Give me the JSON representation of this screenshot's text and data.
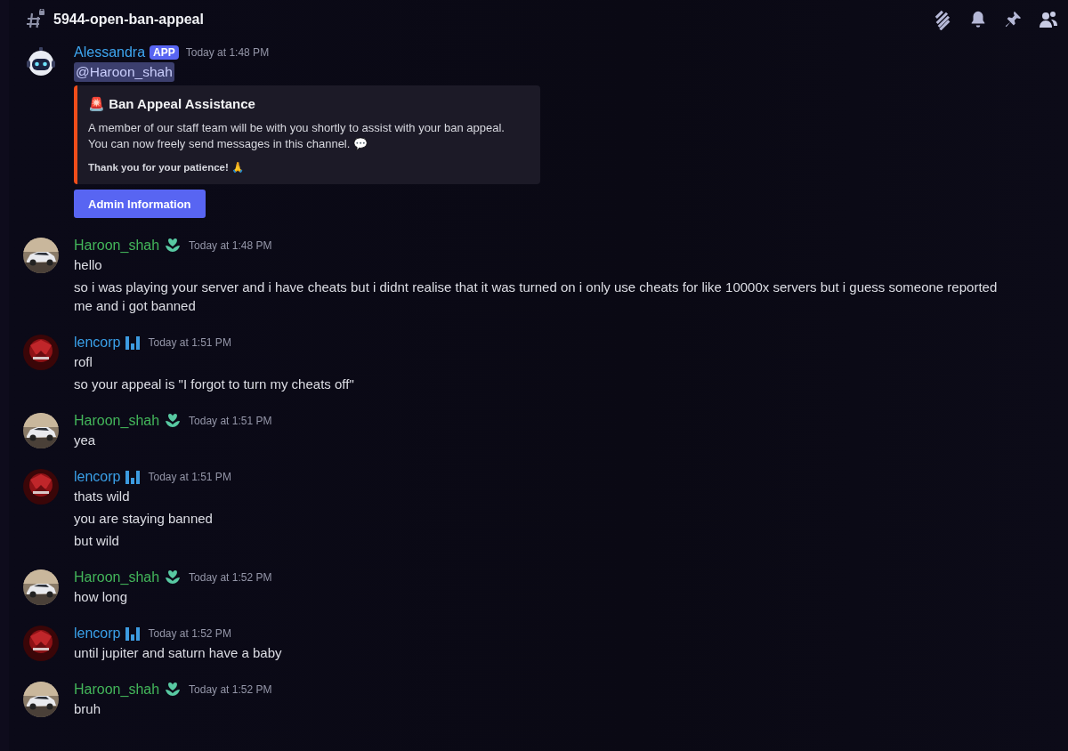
{
  "channel": {
    "name": "5944-open-ban-appeal"
  },
  "toolbar": [
    {
      "kind": "threads"
    },
    {
      "kind": "bell"
    },
    {
      "kind": "pin"
    },
    {
      "kind": "members"
    }
  ],
  "messages": [
    {
      "avatar": {
        "kind": "robot"
      },
      "author": "Alessandra",
      "color": "#3ea6f0",
      "badge": {
        "kind": "app",
        "text": "APP"
      },
      "time": "Today at 1:48 PM",
      "mention": "@Haroon_shah",
      "embed": {
        "icon": "🚨",
        "title": "Ban Appeal Assistance",
        "body": [
          "A member of our staff team will be with you shortly to assist with your ban appeal.",
          "You can now freely send messages in this channel. 💬"
        ],
        "footer": "Thank you for your patience! 🙏"
      },
      "button": "Admin Information"
    },
    {
      "avatar": {
        "kind": "car"
      },
      "author": "Haroon_shah",
      "color": "#43b55a",
      "badge": {
        "kind": "plant"
      },
      "time": "Today at 1:48 PM",
      "lines": [
        "hello",
        "so i was playing your server and i have cheats but i didnt realise that it was turned on i only use cheats for like 10000x servers but i guess someone reported me and i got banned"
      ]
    },
    {
      "avatar": {
        "kind": "logo"
      },
      "author": "lencorp",
      "color": "#3aa0e8",
      "badge": {
        "kind": "bars"
      },
      "time": "Today at 1:51 PM",
      "lines": [
        "rofl",
        "so your appeal is \"I forgot to turn my cheats off\""
      ]
    },
    {
      "avatar": {
        "kind": "car"
      },
      "author": "Haroon_shah",
      "color": "#43b55a",
      "badge": {
        "kind": "plant"
      },
      "time": "Today at 1:51 PM",
      "lines": [
        "yea"
      ]
    },
    {
      "avatar": {
        "kind": "logo"
      },
      "author": "lencorp",
      "color": "#3aa0e8",
      "badge": {
        "kind": "bars"
      },
      "time": "Today at 1:51 PM",
      "lines": [
        "thats wild",
        "you are staying banned",
        "but wild"
      ]
    },
    {
      "avatar": {
        "kind": "car"
      },
      "author": "Haroon_shah",
      "color": "#43b55a",
      "badge": {
        "kind": "plant"
      },
      "time": "Today at 1:52 PM",
      "lines": [
        "how long"
      ]
    },
    {
      "avatar": {
        "kind": "logo"
      },
      "author": "lencorp",
      "color": "#3aa0e8",
      "badge": {
        "kind": "bars"
      },
      "time": "Today at 1:52 PM",
      "lines": [
        "until jupiter and saturn have a baby"
      ]
    },
    {
      "avatar": {
        "kind": "car"
      },
      "author": "Haroon_shah",
      "color": "#43b55a",
      "badge": {
        "kind": "plant"
      },
      "time": "Today at 1:52 PM",
      "lines": [
        "bruh"
      ]
    }
  ]
}
